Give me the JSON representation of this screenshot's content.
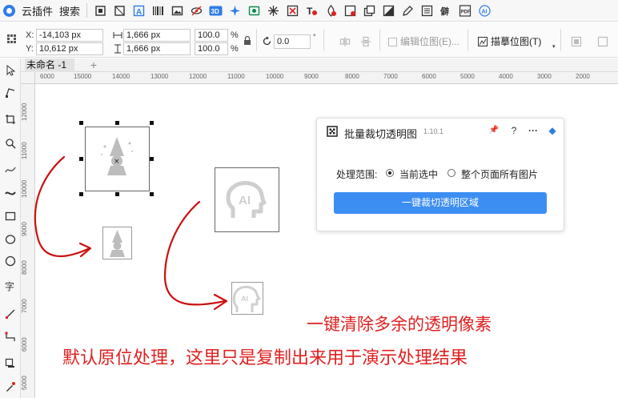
{
  "menubar": {
    "brand": "云插件",
    "search": "搜索",
    "tool_icons": [
      "frame-icon",
      "crop-icon",
      "text-frame-icon",
      "barcode-icon",
      "image-icon",
      "eye-off-icon",
      "3d-icon",
      "magic-icon",
      "bookmark-icon",
      "sparkle-icon",
      "delete-icon",
      "text-delete-icon",
      "color-icon",
      "image-edit-icon",
      "layers-icon",
      "contrast-icon",
      "pen-icon",
      "list-icon",
      "font-icon",
      "pdf-icon",
      "ai-icon"
    ],
    "icon_labels": {
      "three_d": "3D",
      "pdf": "PDF",
      "ai": "AI"
    }
  },
  "propbar": {
    "x_label": "X:",
    "x_value": "-14,103 px",
    "y_label": "Y:",
    "y_value": "10,612 px",
    "w_value": "1,666 px",
    "h_value": "1,666 px",
    "scale_x": "100.0",
    "scale_y": "100.0",
    "pct": "%",
    "angle": "0.0",
    "edit_bitmap": "编辑位图(E)...",
    "trace_bitmap": "描摹位图(T)"
  },
  "tab": {
    "name": "未命名 -1",
    "add": "+"
  },
  "ruler": {
    "h_ticks": [
      "6000",
      "15000",
      "14000",
      "13000",
      "12000",
      "11000",
      "10000",
      "9000",
      "8000",
      "7000",
      "6000",
      "5000",
      "4000",
      "3000",
      "2000"
    ],
    "v_ticks": [
      "12000",
      "11000",
      "10000",
      "9000",
      "8000",
      "7000",
      "6000",
      "5000"
    ]
  },
  "canvas": {
    "ai_label": "AI",
    "selected_marker": "×"
  },
  "panel": {
    "title": "批量裁切透明图",
    "version": "1.10.1",
    "range_label": "处理范围:",
    "option_current": "当前选中",
    "option_all": "整个页面所有图片",
    "action": "一键裁切透明区域",
    "btn_pin": "📌",
    "btn_help": "?",
    "btn_more": "···",
    "btn_drop": "◆"
  },
  "captions": {
    "line1": "一键清除多余的透明像素",
    "line2": "默认原位处理，这里只是复制出来用于演示处理结果"
  },
  "colors": {
    "accent": "#3d8ef2",
    "caption": "#e02020",
    "arrow": "#cc1111"
  }
}
